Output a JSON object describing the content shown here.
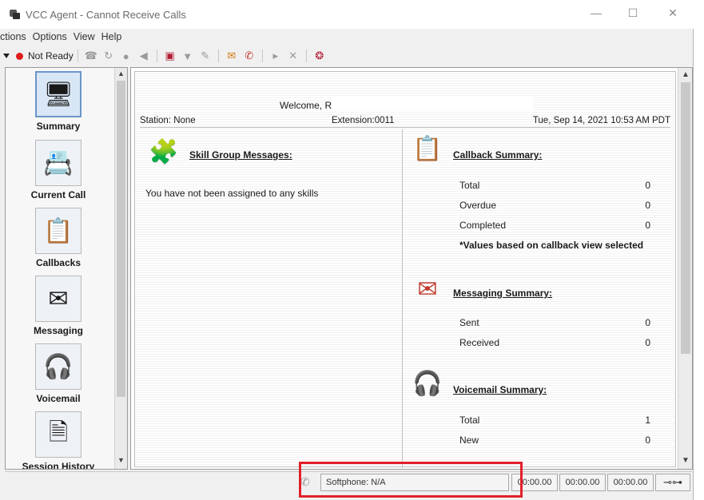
{
  "window": {
    "title": "VCC Agent - Cannot Receive Calls",
    "controls": {
      "minimize": "—",
      "maximize": "☐",
      "close": "✕"
    }
  },
  "menu": [
    "ctions",
    "Options",
    "View",
    "Help"
  ],
  "toolbar": {
    "status": "Not Ready",
    "status_color": "#e01b1b",
    "buttons": [
      "ready-icon",
      "refresh-icon",
      "record-icon",
      "mute-icon",
      "book-icon",
      "shirt-icon",
      "pen-icon",
      "envelope-icon",
      "chat-icon",
      "play-icon",
      "close-icon",
      "lifebuoy-icon"
    ]
  },
  "sidebar": {
    "items": [
      {
        "label": "Summary",
        "icon": "summary-icon",
        "active": true
      },
      {
        "label": "Current Call",
        "icon": "phone-call-icon",
        "active": false
      },
      {
        "label": "Callbacks",
        "icon": "callback-clipboard-icon",
        "active": false
      },
      {
        "label": "Messaging",
        "icon": "envelope-icon",
        "active": false
      },
      {
        "label": "Voicemail",
        "icon": "headset-icon",
        "active": false
      },
      {
        "label": "Session History",
        "icon": "history-icon",
        "active": false
      }
    ]
  },
  "main": {
    "welcome": "Welcome, Re",
    "station": "Station: None",
    "extension": "Extension:0011",
    "datetime": "Tue, Sep 14, 2021 10:53 AM PDT",
    "skill_group": {
      "title": "Skill Group Messages:",
      "message": "You have not been assigned to any skills"
    },
    "callback_summary": {
      "title": "Callback Summary:",
      "rows": [
        {
          "label": "Total",
          "value": "0"
        },
        {
          "label": "Overdue",
          "value": "0"
        },
        {
          "label": "Completed",
          "value": "0"
        }
      ],
      "note": "*Values based on callback view selected"
    },
    "messaging_summary": {
      "title": "Messaging Summary:",
      "rows": [
        {
          "label": "Sent",
          "value": "0"
        },
        {
          "label": "Received",
          "value": "0"
        }
      ]
    },
    "voicemail_summary": {
      "title": "Voicemail Summary:",
      "rows": [
        {
          "label": "Total",
          "value": "1"
        },
        {
          "label": "New",
          "value": "0"
        }
      ]
    }
  },
  "statusbar": {
    "softphone": "Softphone: N/A",
    "timer1": "00:00.00",
    "timer2": "00:00.00",
    "timer3": "00:00.00"
  },
  "colors": {
    "highlight": "#e3202a",
    "active_nav_border": "#6b95c9"
  }
}
